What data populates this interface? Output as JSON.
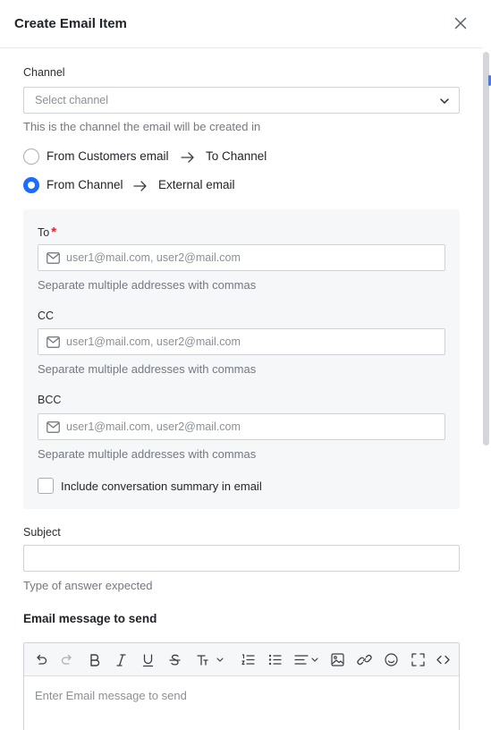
{
  "header": {
    "title": "Create Email Item"
  },
  "channel": {
    "label": "Channel",
    "placeholder": "Select channel",
    "help": "This is the channel the email will be created in"
  },
  "direction": {
    "option1": {
      "from": "From Customers email",
      "to": "To Channel",
      "checked": false
    },
    "option2": {
      "from": "From Channel",
      "to": "External email",
      "checked": true
    }
  },
  "recipients": {
    "to": {
      "label": "To",
      "required_mark": "*",
      "placeholder": "user1@mail.com, user2@mail.com",
      "help": "Separate multiple addresses with commas"
    },
    "cc": {
      "label": "CC",
      "placeholder": "user1@mail.com, user2@mail.com",
      "help": "Separate multiple addresses with commas"
    },
    "bcc": {
      "label": "BCC",
      "placeholder": "user1@mail.com, user2@mail.com",
      "help": "Separate multiple addresses with commas"
    },
    "summary_checkbox": {
      "label": "Include conversation summary in email",
      "checked": false
    }
  },
  "subject": {
    "label": "Subject",
    "value": "",
    "help": "Type of answer expected"
  },
  "message": {
    "title": "Email message to send",
    "placeholder": "Enter Email message to send",
    "toolbar": [
      "undo-icon",
      "redo-icon",
      "bold-icon",
      "italic-icon",
      "underline-icon",
      "strikethrough-icon",
      "text-size-icon",
      "ordered-list-icon",
      "bullet-list-icon",
      "align-icon",
      "image-icon",
      "link-icon",
      "emoji-icon",
      "fullscreen-icon",
      "code-icon"
    ]
  },
  "colors": {
    "accent": "#1a6dff",
    "required": "#e0262c",
    "panel": "#f6f7f9"
  }
}
